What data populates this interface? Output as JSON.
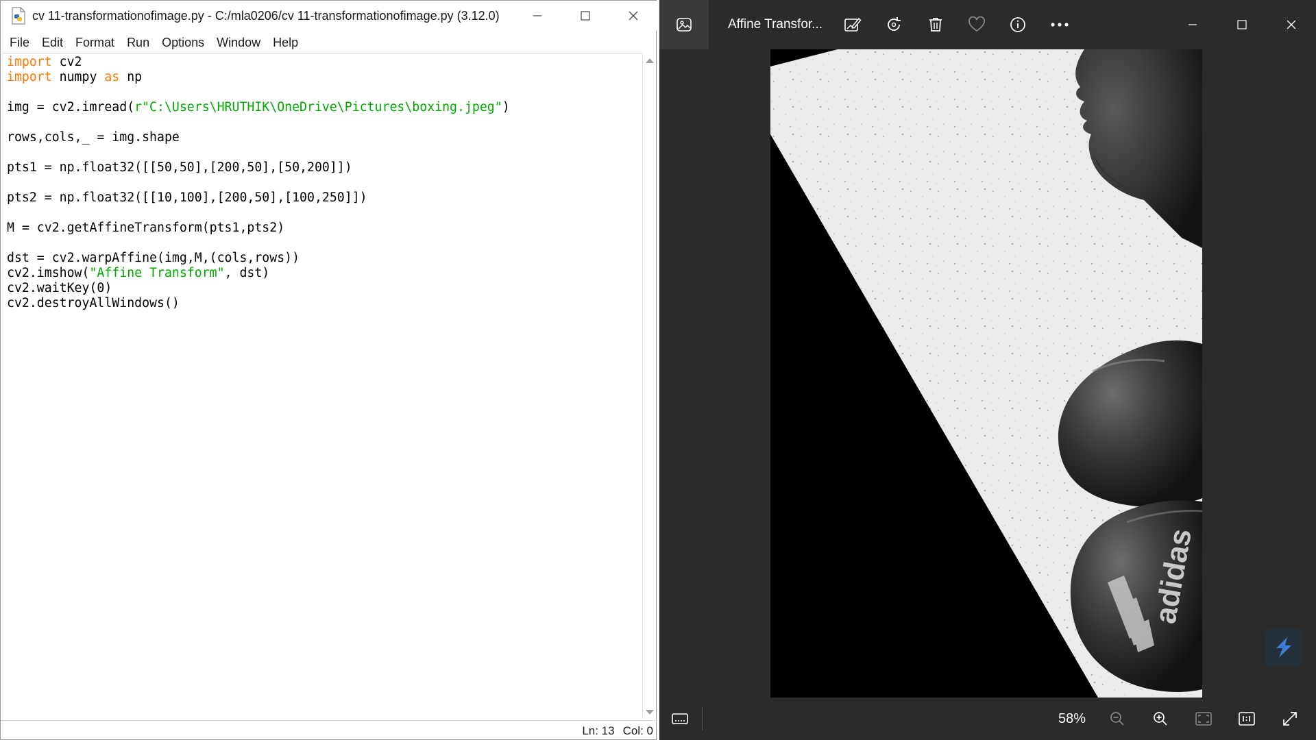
{
  "idle": {
    "title": "cv 11-transformationofimage.py - C:/mla0206/cv 11-transformationofimage.py (3.12.0)",
    "menu": [
      "File",
      "Edit",
      "Format",
      "Run",
      "Options",
      "Window",
      "Help"
    ],
    "code_lines": [
      [
        {
          "t": "import",
          "c": "kw"
        },
        {
          "t": " cv2"
        }
      ],
      [
        {
          "t": "import",
          "c": "kw"
        },
        {
          "t": " numpy "
        },
        {
          "t": "as",
          "c": "kw"
        },
        {
          "t": " np"
        }
      ],
      [],
      [
        {
          "t": "img = cv2.imread("
        },
        {
          "t": "r\"C:\\Users\\HRUTHIK\\OneDrive\\Pictures\\boxing.jpeg\"",
          "c": "str"
        },
        {
          "t": ")"
        }
      ],
      [],
      [
        {
          "t": "rows,cols,_ = img.shape"
        }
      ],
      [],
      [
        {
          "t": "pts1 = np.float32([[50,50],[200,50],[50,200]])"
        }
      ],
      [],
      [
        {
          "t": "pts2 = np.float32([[10,100],[200,50],[100,250]])"
        }
      ],
      [],
      [
        {
          "t": "M = cv2.getAffineTransform(pts1,pts2)"
        }
      ],
      [],
      [
        {
          "t": "dst = cv2.warpAffine(img,M,(cols,rows))"
        }
      ],
      [
        {
          "t": "cv2.imshow("
        },
        {
          "t": "\"Affine Transform\"",
          "c": "str"
        },
        {
          "t": ", dst)"
        }
      ],
      [
        {
          "t": "cv2.waitKey(0)"
        }
      ],
      [
        {
          "t": "cv2.destroyAllWindows()"
        }
      ]
    ],
    "status": {
      "line": "Ln: 13",
      "col": "Col: 0"
    }
  },
  "photos": {
    "title": "Affine Transfor...",
    "zoom": "58%",
    "brand_text": "adidas",
    "toolbar_icons": [
      "edit-image-icon",
      "rotate-icon",
      "delete-icon",
      "favorite-icon",
      "info-icon",
      "more-icon"
    ],
    "bottom_icons": [
      "filmstrip-icon",
      "zoom-out-icon",
      "zoom-in-icon",
      "fit-to-window-icon",
      "actual-size-icon",
      "fullscreen-icon"
    ]
  },
  "colors": {
    "keyword": "#ff7700",
    "string": "#00aa00",
    "photos_bg": "#2b2b2b"
  }
}
